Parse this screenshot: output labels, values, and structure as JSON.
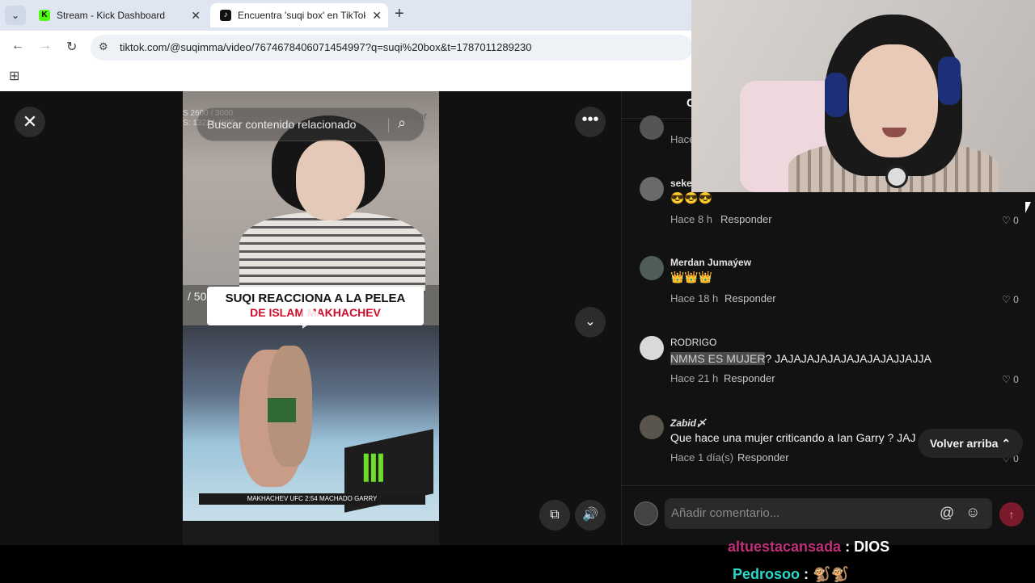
{
  "browser": {
    "tabs": [
      {
        "title": "Stream - Kick Dashboard",
        "favicon": "K",
        "active": false
      },
      {
        "title": "Encuentra 'suqi box' en TikTok |",
        "favicon": "♪",
        "active": true
      }
    ],
    "url": "tiktok.com/@suqimma/video/7674678406071454997?q=suqi%20box&t=1787011289230"
  },
  "video": {
    "search_placeholder": "Buscar contenido relacionado",
    "ghost_right": "no tor",
    "overlay_stats": "S 2600 / 3000\nS: 13224 4995",
    "left_count": "/ 50",
    "caption_line1": "SUQI REACCIONA A LA PELEA",
    "caption_line2": "DE ISLAM MAKHACHEV",
    "scoreboard": "MAKHACHEV   UFC 2:54   MACHADO GARRY"
  },
  "comments": [
    {
      "name": "",
      "text": "",
      "time": "Hace",
      "reply": "",
      "likes": ""
    },
    {
      "name": "seke",
      "text": "😎😎😎",
      "time": "Hace 8 h",
      "reply": "Responder",
      "likes": "0"
    },
    {
      "name": "Merdan Jumaýew",
      "text": "👑👑👑",
      "time": "Hace 18 h",
      "reply": "Responder",
      "likes": "0"
    },
    {
      "name": "RODRIGO",
      "text_highlight": "NMMS ES MUJER",
      "text": "? JAJAJAJAJAJAJAJAJAJJAJJA",
      "time": "Hace 21 h",
      "reply": "Responder",
      "likes": "0"
    },
    {
      "name": "Zabid〆",
      "text": "Que hace una mujer criticando a Ian Garry ? JAJ",
      "time": "Hace 1 día(s)",
      "reply": "Responder",
      "likes": "0"
    }
  ],
  "panel": {
    "header_fragment": "C",
    "back_to_top": "Volver arriba",
    "composer_placeholder": "Añadir comentario..."
  },
  "chat": {
    "line1_user": "altuestacansada",
    "line1_msg": ": DIOS",
    "line2_user": "Pedrosoo",
    "line2_msg": ": 🐒🐒"
  },
  "colors": {
    "accent": "#fe2c55",
    "kick_green": "#53fc18"
  }
}
